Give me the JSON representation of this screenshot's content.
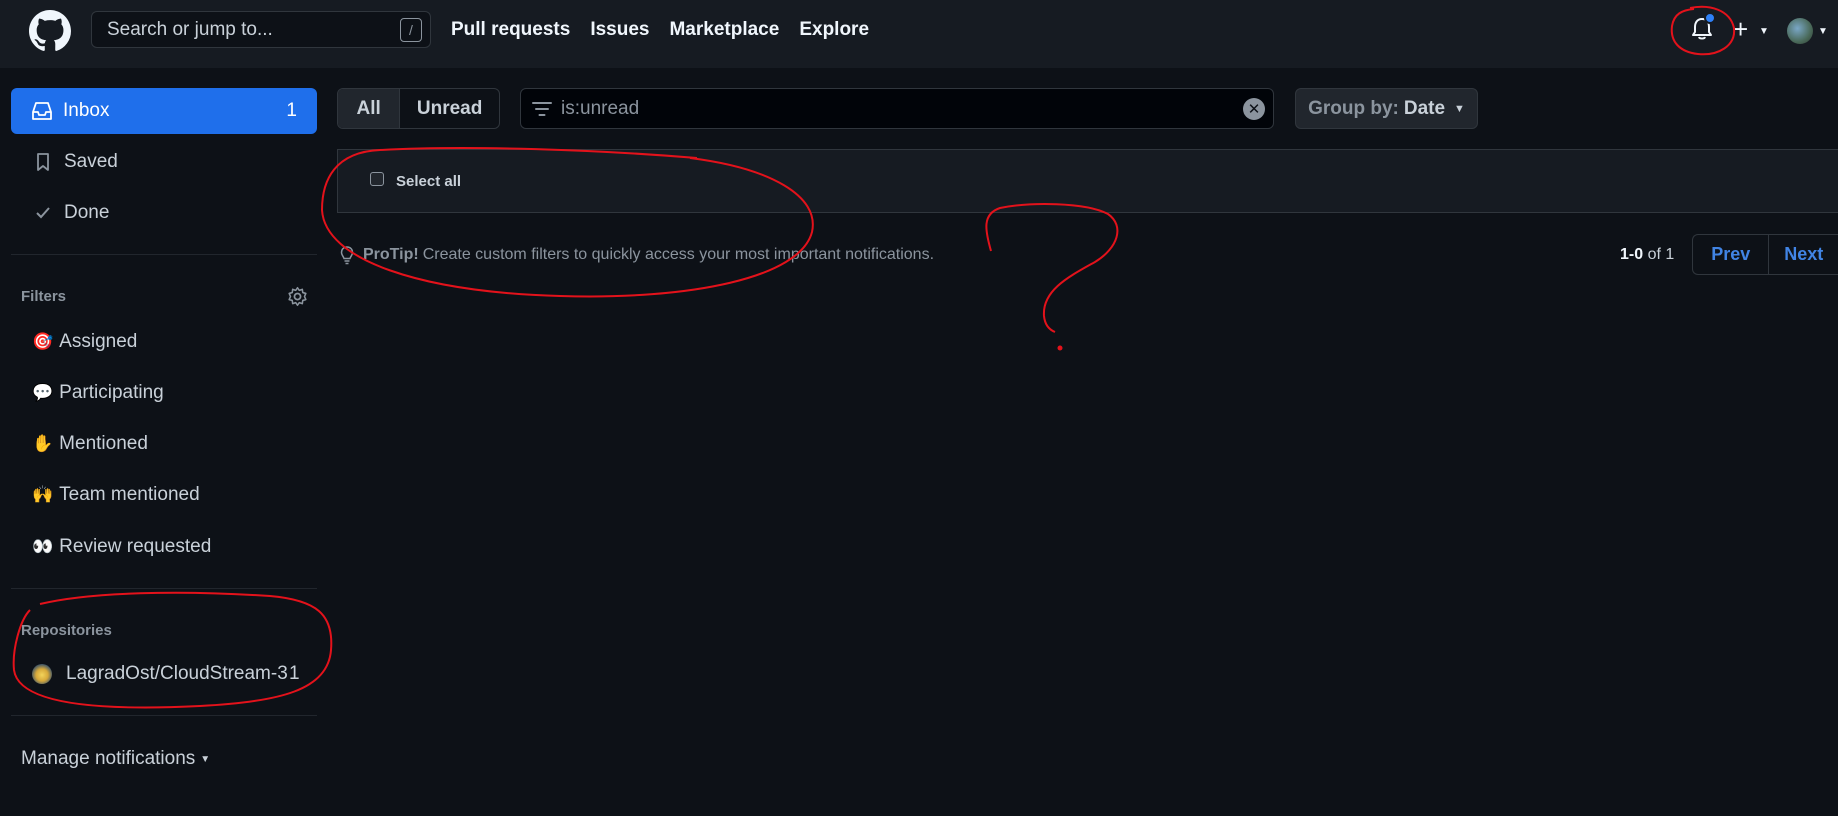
{
  "header": {
    "search_placeholder": "Search or jump to...",
    "search_shortcut": "/",
    "nav": [
      "Pull requests",
      "Issues",
      "Marketplace",
      "Explore"
    ]
  },
  "sidebar": {
    "inbox_label": "Inbox",
    "inbox_count": "1",
    "saved_label": "Saved",
    "done_label": "Done",
    "filters_title": "Filters",
    "filters": [
      {
        "emoji": "🎯",
        "label": "Assigned"
      },
      {
        "emoji": "💬",
        "label": "Participating"
      },
      {
        "emoji": "✋",
        "label": "Mentioned"
      },
      {
        "emoji": "🙌",
        "label": "Team mentioned"
      },
      {
        "emoji": "👀",
        "label": "Review requested"
      }
    ],
    "repos_title": "Repositories",
    "repo_name": "LagradOst/CloudStream-3",
    "repo_count": "1",
    "manage_label": "Manage notifications"
  },
  "toolbar": {
    "all_label": "All",
    "unread_label": "Unread",
    "filter_value": "is:unread",
    "groupby_prefix": "Group by:",
    "groupby_value": "Date"
  },
  "list": {
    "select_all": "Select all"
  },
  "protip": {
    "lead": "ProTip!",
    "text": "Create custom filters to quickly access your most important notifications."
  },
  "pagination": {
    "range": "1-0",
    "of_text": "of 1",
    "prev": "Prev",
    "next": "Next"
  },
  "colors": {
    "accent": "#1f6feb",
    "annotation": "#e3121b"
  }
}
